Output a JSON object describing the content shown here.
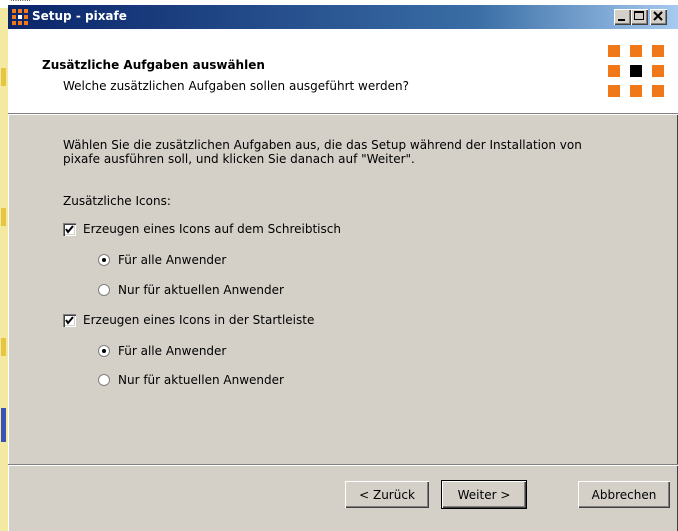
{
  "window": {
    "title": "Setup - pixafe",
    "controls": {
      "minimize": "minimize-icon",
      "maximize": "maximize-icon",
      "close": "close-icon"
    }
  },
  "header": {
    "title": "Zusätzliche Aufgaben auswählen",
    "subtitle": "Welche zusätzlichen Aufgaben sollen ausgeführt werden?"
  },
  "body": {
    "intro_line1": "Wählen Sie die zusätzlichen Aufgaben aus, die das Setup während der Installation von",
    "intro_line2": "pixafe ausführen soll, und klicken Sie danach auf \"Weiter\".",
    "section_label": "Zusätzliche Icons:",
    "tasks": [
      {
        "label": "Erzeugen eines Icons auf dem Schreibtisch",
        "checked": true,
        "options": [
          {
            "label": "Für alle Anwender",
            "selected": true
          },
          {
            "label": "Nur für aktuellen Anwender",
            "selected": false
          }
        ]
      },
      {
        "label": "Erzeugen eines Icons in der Startleiste",
        "checked": true,
        "options": [
          {
            "label": "Für alle Anwender",
            "selected": true
          },
          {
            "label": "Nur für aktuellen Anwender",
            "selected": false
          }
        ]
      }
    ]
  },
  "buttons": {
    "back": "< Zurück",
    "next": "Weiter >",
    "cancel": "Abbrechen"
  },
  "colors": {
    "titlebar_start": "#0a246a",
    "titlebar_end": "#a6caf0",
    "logo_orange": "#f07818",
    "logo_black": "#000000"
  }
}
